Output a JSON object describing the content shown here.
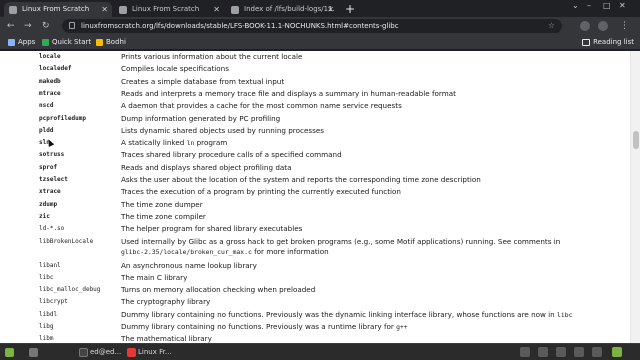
{
  "browser": {
    "tabs": [
      {
        "title": "Linux From Scratch",
        "active": true
      },
      {
        "title": "Linux From Scratch",
        "active": false
      },
      {
        "title": "Index of /lfs/build-logs/11.",
        "active": false
      }
    ],
    "new_tab": "+",
    "window_controls": [
      "⌄",
      "–",
      "□",
      "✕"
    ],
    "nav": {
      "back": "←",
      "forward": "→",
      "reload": "↻"
    },
    "url": "linuxfromscratch.org/lfs/downloads/stable/LFS-BOOK-11.1-NOCHUNKS.html#contents-glibc",
    "bookmarks": [
      {
        "label": "Apps",
        "color": "#8ab4f8"
      },
      {
        "label": "Quick Start",
        "color": "#34a853"
      },
      {
        "label": "Bodhi",
        "color": "#fbbc04"
      }
    ],
    "reading_list": "Reading list"
  },
  "content": {
    "rows": [
      {
        "name": "locale",
        "desc": "Prints various information about the current locale"
      },
      {
        "name": "localedef",
        "desc": "Compiles locale specifications"
      },
      {
        "name": "makedb",
        "desc": "Creates a simple database from textual input"
      },
      {
        "name": "mtrace",
        "desc": "Reads and interprets a memory trace file and displays a summary in human-readable format"
      },
      {
        "name": "nscd",
        "desc": "A daemon that provides a cache for the most common name service requests"
      },
      {
        "name": "pcprofiledump",
        "desc": "Dump information generated by PC profiling"
      },
      {
        "name": "pldd",
        "desc": "Lists dynamic shared objects used by running processes"
      },
      {
        "name": "sln",
        "desc": "A statically linked ",
        "code": "ln",
        "desc_after": " program"
      },
      {
        "name": "sotruss",
        "desc": "Traces shared library procedure calls of a specified command"
      },
      {
        "name": "sprof",
        "desc": "Reads and displays shared object profiling data"
      },
      {
        "name": "tzselect",
        "desc": "Asks the user about the location of the system and reports the corresponding time zone description"
      },
      {
        "name": "xtrace",
        "desc": "Traces the execution of a program by printing the currently executed function"
      },
      {
        "name": "zdump",
        "desc": "The time zone dumper"
      },
      {
        "name": "zic",
        "desc": "The time zone compiler"
      },
      {
        "name": "ld-*.so",
        "desc": "The helper program for shared library executables",
        "plain": true
      },
      {
        "name": "libBrokenLocale",
        "desc": "Used internally by Glibc as a gross hack to get broken programs (e.g., some Motif applications) running. See comments in",
        "desc2_code": "glibc-2.35/locale/broken_cur_max.c",
        "desc2": " for more information",
        "plain": true,
        "tall": true
      },
      {
        "name": "libanl",
        "desc": "An asynchronous name lookup library",
        "plain": true
      },
      {
        "name": "libc",
        "desc": "The main C library",
        "plain": true
      },
      {
        "name": "libc_malloc_debug",
        "desc": "Turns on memory allocation checking when preloaded",
        "plain": true
      },
      {
        "name": "libcrypt",
        "desc": "The cryptography library",
        "plain": true
      },
      {
        "name": "libdl",
        "desc": "Dummy library containing no functions. Previously was the dynamic linking interface library, whose functions are now in ",
        "code": "libc",
        "plain": true
      },
      {
        "name": "libg",
        "desc": "Dummy library containing no functions. Previously was a runtime library for ",
        "code": "g++",
        "plain": true
      },
      {
        "name": "libm",
        "desc": "The mathematical library",
        "plain": true
      }
    ]
  },
  "taskbar": {
    "items": [
      {
        "label": "",
        "color": "#7cb342"
      },
      {
        "label": "",
        "color": "#555555"
      },
      {
        "label": "ed@ed...",
        "color": "#444444"
      },
      {
        "label": "Linux Fr...",
        "color": "#e53935"
      }
    ]
  }
}
